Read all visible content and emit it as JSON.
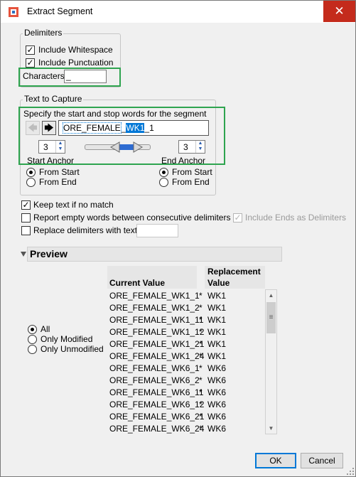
{
  "window": {
    "title": "Extract Segment",
    "close_symbol": "✕"
  },
  "delimiters": {
    "title": "Delimiters",
    "include_whitespace": {
      "label": "Include Whitespace",
      "checked": true
    },
    "include_punctuation": {
      "label": "Include Punctuation",
      "checked": true
    },
    "characters": {
      "label": "Characters",
      "value": "_"
    }
  },
  "text_to_capture": {
    "title": "Text to Capture",
    "instruction": "Specify the start and stop words for the segment",
    "sample_parts": [
      "ORE_FEMALE",
      "_",
      "WK1",
      "_1"
    ],
    "start_anchor": {
      "value": "3",
      "label": "Start Anchor",
      "options": [
        "From Start",
        "From End"
      ],
      "selected": "From Start"
    },
    "end_anchor": {
      "value": "3",
      "label": "End Anchor",
      "options": [
        "From Start",
        "From End"
      ],
      "selected": "From Start"
    }
  },
  "options": {
    "keep_text": {
      "label": "Keep text if no match",
      "checked": true
    },
    "report_empty": {
      "label": "Report empty words between consecutive delimiters",
      "checked": false
    },
    "include_ends": {
      "label": "Include Ends as Delimiters",
      "checked": true,
      "disabled": true
    },
    "replace_delims": {
      "label": "Replace delimiters with text",
      "checked": false,
      "value": ""
    }
  },
  "preview": {
    "title": "Preview",
    "filters": [
      "All",
      "Only Modified",
      "Only Unmodified"
    ],
    "selected_filter": "All",
    "columns": {
      "current": "Current Value",
      "replacement_line1": "Replacement",
      "replacement_line2": "Value"
    },
    "rows": [
      {
        "current": "ORE_FEMALE_WK1_1",
        "mark": "*",
        "replacement": "WK1"
      },
      {
        "current": "ORE_FEMALE_WK1_2",
        "mark": "*",
        "replacement": "WK1"
      },
      {
        "current": "ORE_FEMALE_WK1_11",
        "mark": "*",
        "replacement": "WK1"
      },
      {
        "current": "ORE_FEMALE_WK1_12",
        "mark": "*",
        "replacement": "WK1"
      },
      {
        "current": "ORE_FEMALE_WK1_21",
        "mark": "*",
        "replacement": "WK1"
      },
      {
        "current": "ORE_FEMALE_WK1_24",
        "mark": "*",
        "replacement": "WK1"
      },
      {
        "current": "ORE_FEMALE_WK6_1",
        "mark": "*",
        "replacement": "WK6"
      },
      {
        "current": "ORE_FEMALE_WK6_2",
        "mark": "*",
        "replacement": "WK6"
      },
      {
        "current": "ORE_FEMALE_WK6_11",
        "mark": "*",
        "replacement": "WK6"
      },
      {
        "current": "ORE_FEMALE_WK6_12",
        "mark": "*",
        "replacement": "WK6"
      },
      {
        "current": "ORE_FEMALE_WK6_21",
        "mark": "*",
        "replacement": "WK6"
      },
      {
        "current": "ORE_FEMALE_WK6_24",
        "mark": "*",
        "replacement": "WK6"
      }
    ]
  },
  "buttons": {
    "ok": "OK",
    "cancel": "Cancel"
  },
  "colors": {
    "highlight": "#2ea44f",
    "selection": "#0078d7",
    "close": "#c42b1c"
  }
}
